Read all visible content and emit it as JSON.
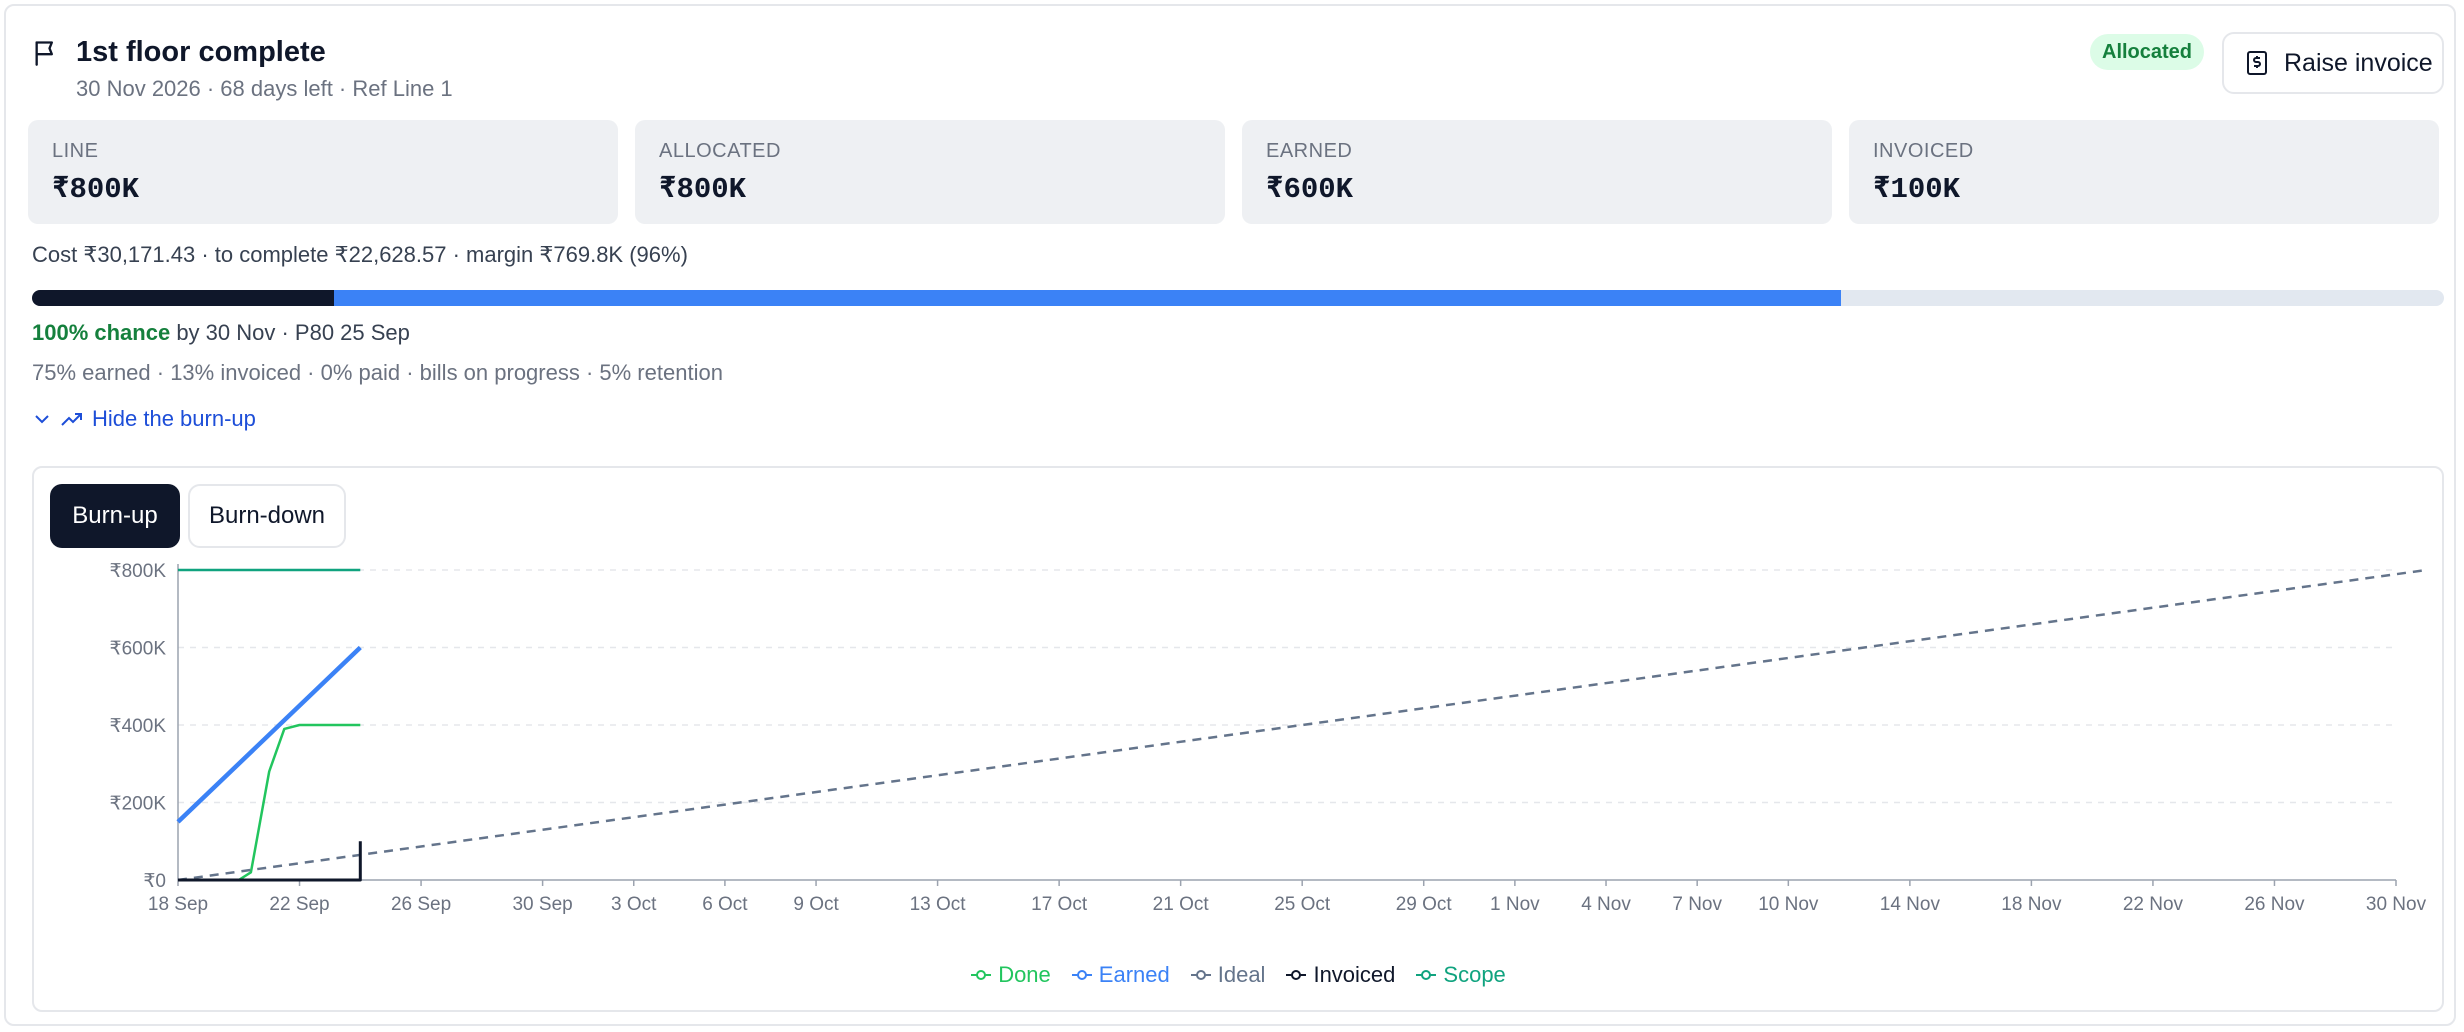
{
  "header": {
    "title": "1st floor complete",
    "subtitle": "30 Nov 2026 · 68 days left · Ref Line 1",
    "badge": "Allocated",
    "raise_invoice_label": "Raise invoice"
  },
  "stats": [
    {
      "label": "LINE",
      "value": "₹800K"
    },
    {
      "label": "ALLOCATED",
      "value": "₹800K"
    },
    {
      "label": "EARNED",
      "value": "₹600K"
    },
    {
      "label": "INVOICED",
      "value": "₹100K"
    }
  ],
  "cost_line": "Cost ₹30,171.43 · to complete ₹22,628.57 · margin ₹769.8K (96%)",
  "progress": {
    "invoiced_fraction": 0.125,
    "earned_fraction": 0.75,
    "colors": {
      "invoiced": "#0f172a",
      "earned": "#3b82f6",
      "track": "#e2e8f0"
    }
  },
  "chance": {
    "strong": "100% chance",
    "rest": " by 30 Nov · P80 25 Sep"
  },
  "summary": "75% earned · 13% invoiced · 0% paid · bills on progress · 5% retention",
  "toggle_label": "Hide the burn-up",
  "tabs": {
    "burnup": "Burn-up",
    "burndown": "Burn-down"
  },
  "chart_data": {
    "type": "line",
    "x_ticks": [
      "18 Sep",
      "22 Sep",
      "26 Sep",
      "30 Sep",
      "3 Oct",
      "6 Oct",
      "9 Oct",
      "13 Oct",
      "17 Oct",
      "21 Oct",
      "25 Oct",
      "29 Oct",
      "1 Nov",
      "4 Nov",
      "7 Nov",
      "10 Nov",
      "14 Nov",
      "18 Nov",
      "22 Nov",
      "26 Nov",
      "30 Nov"
    ],
    "x_tick_days": [
      0,
      4,
      8,
      12,
      15,
      18,
      21,
      25,
      29,
      33,
      37,
      41,
      44,
      47,
      50,
      53,
      57,
      61,
      65,
      69,
      73
    ],
    "y_ticks": [
      "₹0",
      "₹200K",
      "₹400K",
      "₹600K",
      "₹800K"
    ],
    "y_tick_values": [
      0,
      200,
      400,
      600,
      800
    ],
    "ylim": [
      0,
      800
    ],
    "grid": true,
    "legend_position": "bottom-center",
    "series": [
      {
        "name": "Done",
        "color": "#22c55e",
        "points": [
          [
            0,
            0
          ],
          [
            2,
            0
          ],
          [
            2.4,
            20
          ],
          [
            3,
            280
          ],
          [
            3.5,
            390
          ],
          [
            4,
            400
          ],
          [
            6,
            400
          ]
        ]
      },
      {
        "name": "Earned",
        "color": "#3b82f6",
        "points": [
          [
            0,
            150
          ],
          [
            6,
            600
          ]
        ]
      },
      {
        "name": "Ideal",
        "color": "#64748b",
        "dashed": true,
        "points": [
          [
            0,
            0
          ],
          [
            74,
            800
          ]
        ]
      },
      {
        "name": "Invoiced",
        "color": "#0f172a",
        "points": [
          [
            0,
            0
          ],
          [
            6,
            0
          ],
          [
            6,
            100
          ]
        ]
      },
      {
        "name": "Scope",
        "color": "#10a37f",
        "points": [
          [
            0,
            800
          ],
          [
            6,
            800
          ]
        ]
      }
    ]
  }
}
